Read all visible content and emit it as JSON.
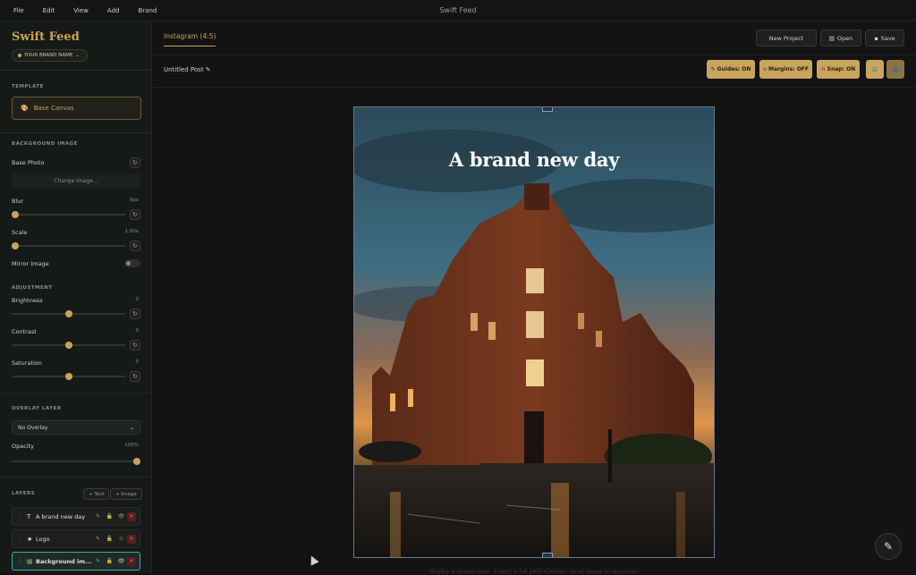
{
  "window": {
    "title": "Swift Feed"
  },
  "menu": [
    "File",
    "Edit",
    "View",
    "Add",
    "Brand"
  ],
  "sidebar": {
    "logo": "Swift Feed",
    "brand_name": "YOUR BRAND NAME",
    "template": {
      "heading": "TEMPLATE",
      "value": "Base Canvas"
    },
    "background": {
      "heading": "BACKGROUND IMAGE",
      "base_photo_label": "Base Photo",
      "change_label": "Change Image...",
      "blur": {
        "label": "Blur",
        "value": "0px",
        "level": 0
      },
      "scale": {
        "label": "Scale",
        "value": "1.00x",
        "level": 0
      },
      "mirror_label": "Mirror Image"
    },
    "adjustment": {
      "heading": "ADJUSTMENT",
      "brightness": {
        "label": "Brightness",
        "value": "0",
        "level": 0.5
      },
      "contrast": {
        "label": "Contrast",
        "value": "0",
        "level": 0.5
      },
      "saturation": {
        "label": "Saturation",
        "value": "0",
        "level": 0.5
      }
    },
    "overlay": {
      "heading": "OVERLAY LAYER",
      "selected": "No Overlay",
      "opacity_label": "Opacity",
      "opacity_value": "100%",
      "opacity_level": 1
    },
    "layers": {
      "heading": "LAYERS",
      "add_text": "+ Text",
      "add_image": "+ Image",
      "items": [
        {
          "type_icon": "T",
          "name": "A brand new day"
        },
        {
          "type_icon": "★",
          "name": "Logo"
        },
        {
          "type_icon": "▦",
          "name": "Background im..."
        }
      ]
    }
  },
  "toolbar": {
    "tab": "Instagram (4:5)",
    "new_project": "New Project",
    "open": "Open",
    "save": "Save",
    "doc_name": "Untitled Post ✎",
    "guides": "Guides: ON",
    "margins": "Margins: OFF",
    "snap": "Snap: ON"
  },
  "canvas": {
    "headline": "A brand new day",
    "footnote": "Display is scaled down. Export is full 2000×2500px. Drag image to reposition."
  },
  "colors": {
    "accent": "#c9a45c",
    "background": "#121212",
    "sidebar": "#161a17",
    "active_layer": "#4aa6a0"
  }
}
